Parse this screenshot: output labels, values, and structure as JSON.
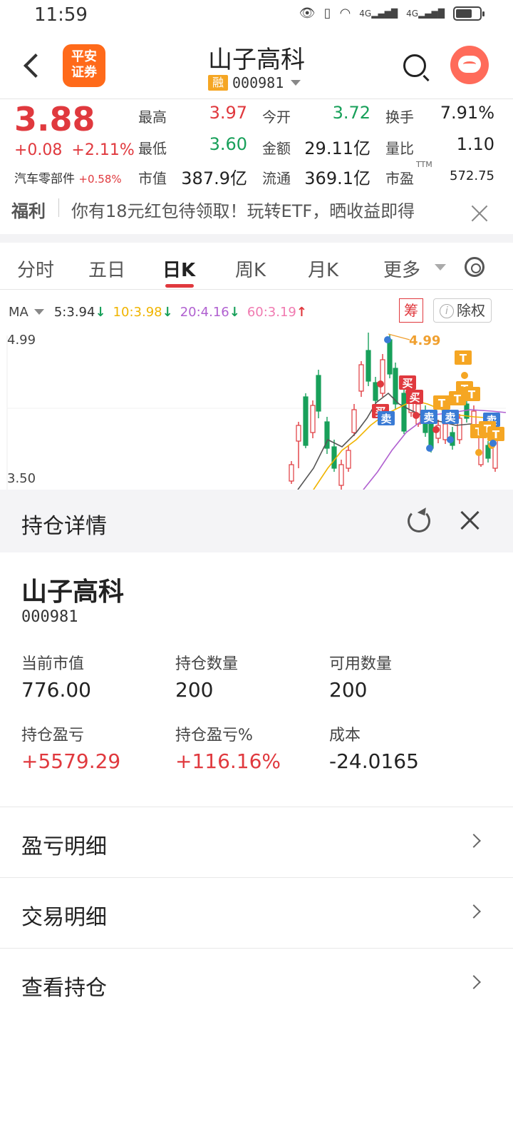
{
  "status_bar": {
    "time": "11:59",
    "net_label": "4G",
    "net_label_2": "4G"
  },
  "header": {
    "title": "山子高科",
    "logo_text_1": "平安",
    "logo_text_2": "证券",
    "margin_badge": "融",
    "code": "000981"
  },
  "quote": {
    "price": "3.88",
    "change": "+0.08",
    "change_pct": "+2.11%",
    "sector_name": "汽车零部件",
    "sector_pct": "+0.58%",
    "fields": [
      {
        "label": "最高",
        "value": "3.97",
        "color": "red"
      },
      {
        "label": "今开",
        "value": "3.72",
        "color": "green"
      },
      {
        "label": "换手",
        "value": "7.91%",
        "color": "dark"
      },
      {
        "label": "最低",
        "value": "3.60",
        "color": "green"
      },
      {
        "label": "金额",
        "value": "29.11亿",
        "color": "dark"
      },
      {
        "label": "量比",
        "value": "1.10",
        "color": "dark"
      },
      {
        "label": "市值",
        "value": "387.9亿",
        "color": "dark"
      },
      {
        "label": "流通",
        "value": "369.1亿",
        "color": "dark"
      },
      {
        "label": "市盈",
        "value": "572.75",
        "color": "dark"
      }
    ],
    "ttm": "TTM"
  },
  "welfare": {
    "label": "福利",
    "text": "你有18元红包待领取！玩转ETF，晒收益即得"
  },
  "tabs": [
    {
      "label": "分时"
    },
    {
      "label": "五日"
    },
    {
      "label": "日K"
    },
    {
      "label": "周K"
    },
    {
      "label": "月K"
    },
    {
      "label": "更多"
    }
  ],
  "ma": {
    "label": "MA",
    "items": [
      {
        "text": "5:3.94",
        "color": "#333333",
        "arrow": "↓",
        "arrow_color": "#18a05a"
      },
      {
        "text": "10:3.98",
        "color": "#f0b400",
        "arrow": "↓",
        "arrow_color": "#18a05a"
      },
      {
        "text": "20:4.16",
        "color": "#b060d0",
        "arrow": "↓",
        "arrow_color": "#18a05a"
      },
      {
        "text": "60:3.19",
        "color": "#f07ab0",
        "arrow": "↑",
        "arrow_color": "#e0393e"
      }
    ],
    "chou": "筹",
    "chuquan": "除权"
  },
  "kline": {
    "y_high": "4.99",
    "y_low": "3.50",
    "max_marker": "4.99",
    "buy_label": "买",
    "sell_label": "卖",
    "t_label": "T"
  },
  "position": {
    "title": "持仓详情",
    "name": "山子高科",
    "code": "000981",
    "metrics": [
      {
        "label": "当前市值",
        "value": "776.00",
        "color": "dark"
      },
      {
        "label": "持仓数量",
        "value": "200",
        "color": "dark"
      },
      {
        "label": "可用数量",
        "value": "200",
        "color": "dark"
      },
      {
        "label": "持仓盈亏",
        "value": "+5579.29",
        "color": "red"
      },
      {
        "label": "持仓盈亏%",
        "value": "+116.16%",
        "color": "red"
      },
      {
        "label": "成本",
        "value": "-24.0165",
        "color": "dark"
      }
    ],
    "links": [
      {
        "label": "盈亏明细"
      },
      {
        "label": "交易明细"
      },
      {
        "label": "查看持仓"
      }
    ]
  },
  "colors": {
    "red": "#e0393e",
    "green": "#18a05a",
    "orange": "#f5a623",
    "blue": "#3a7bd5"
  }
}
